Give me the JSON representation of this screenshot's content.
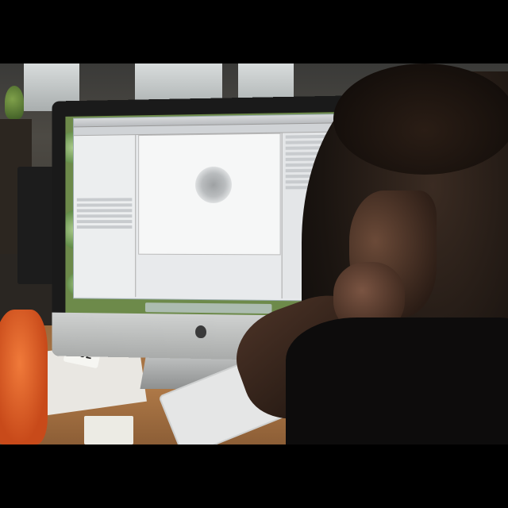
{
  "photo": {
    "sticker_number": "202",
    "packet_text": ""
  }
}
